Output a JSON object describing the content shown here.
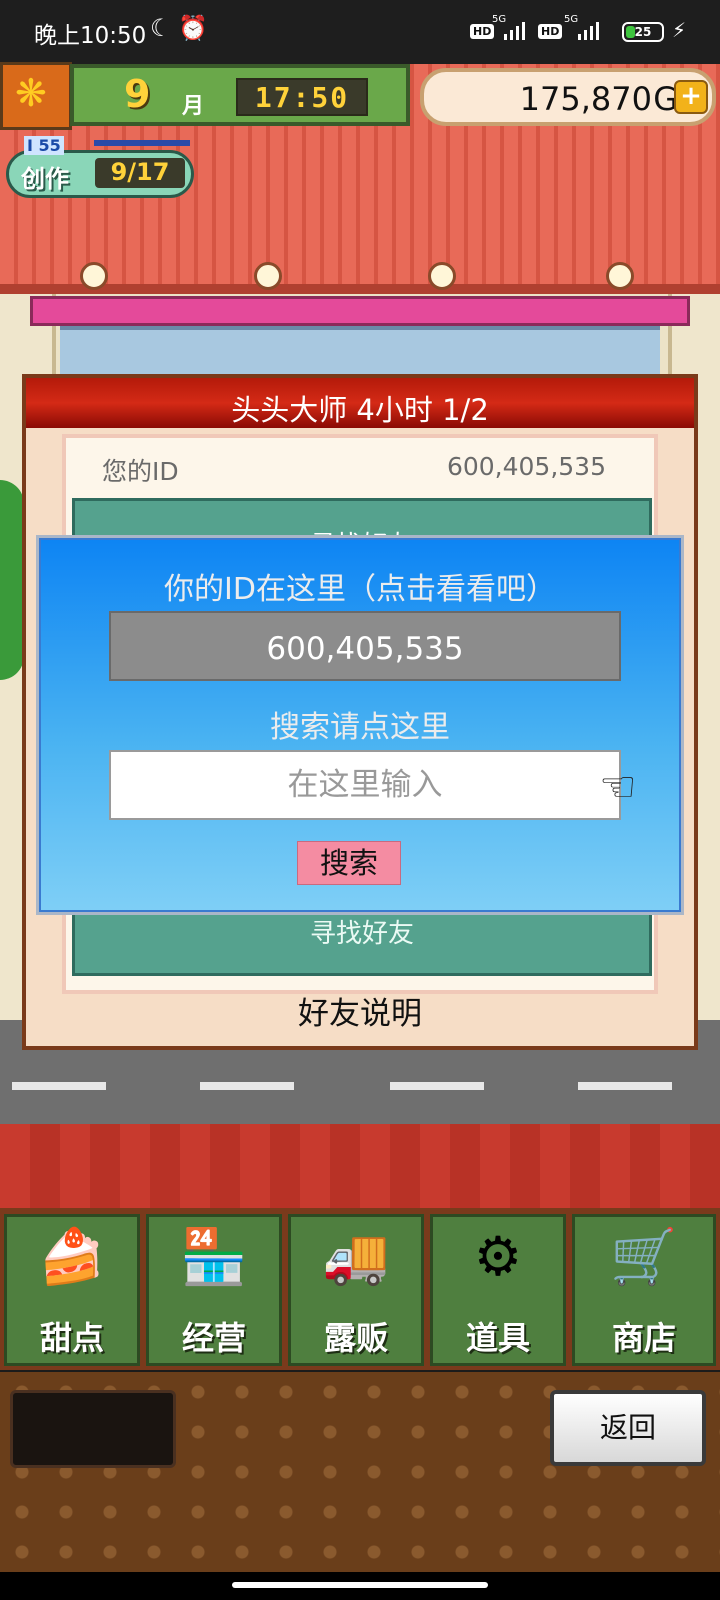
{
  "status_bar": {
    "time": "晚上10:50",
    "battery": "25",
    "battery_level": 0.25,
    "hd": "HD",
    "net": "5G"
  },
  "hud": {
    "month": "9",
    "month_unit": "月",
    "clock": "17:50",
    "money": "175,870",
    "money_unit": "G",
    "add_icon": "plus-icon"
  },
  "create": {
    "level_prefix": "I",
    "level": "55",
    "label": "创作",
    "count": "9/17"
  },
  "dialog": {
    "title": "头头大师  4小时 1/2",
    "id_label": "您的ID",
    "id_value": "600,405,535",
    "find_friends_top": "寻找好友",
    "find_friends_bottom": "寻找好友",
    "friend_info": "好友说明"
  },
  "popup": {
    "title": "你的ID在这里（点击看看吧）",
    "id_value": "600,405,535",
    "search_hint": "搜索请点这里",
    "search_placeholder": "在这里输入",
    "search_button": "搜索"
  },
  "nav": [
    {
      "label": "甜点",
      "icon": "cake-icon"
    },
    {
      "label": "经营",
      "icon": "shop-icon"
    },
    {
      "label": "露贩",
      "icon": "food-truck-icon"
    },
    {
      "label": "道具",
      "icon": "items-bag-icon"
    },
    {
      "label": "商店",
      "icon": "cart-icon"
    }
  ],
  "back_button": "返回"
}
